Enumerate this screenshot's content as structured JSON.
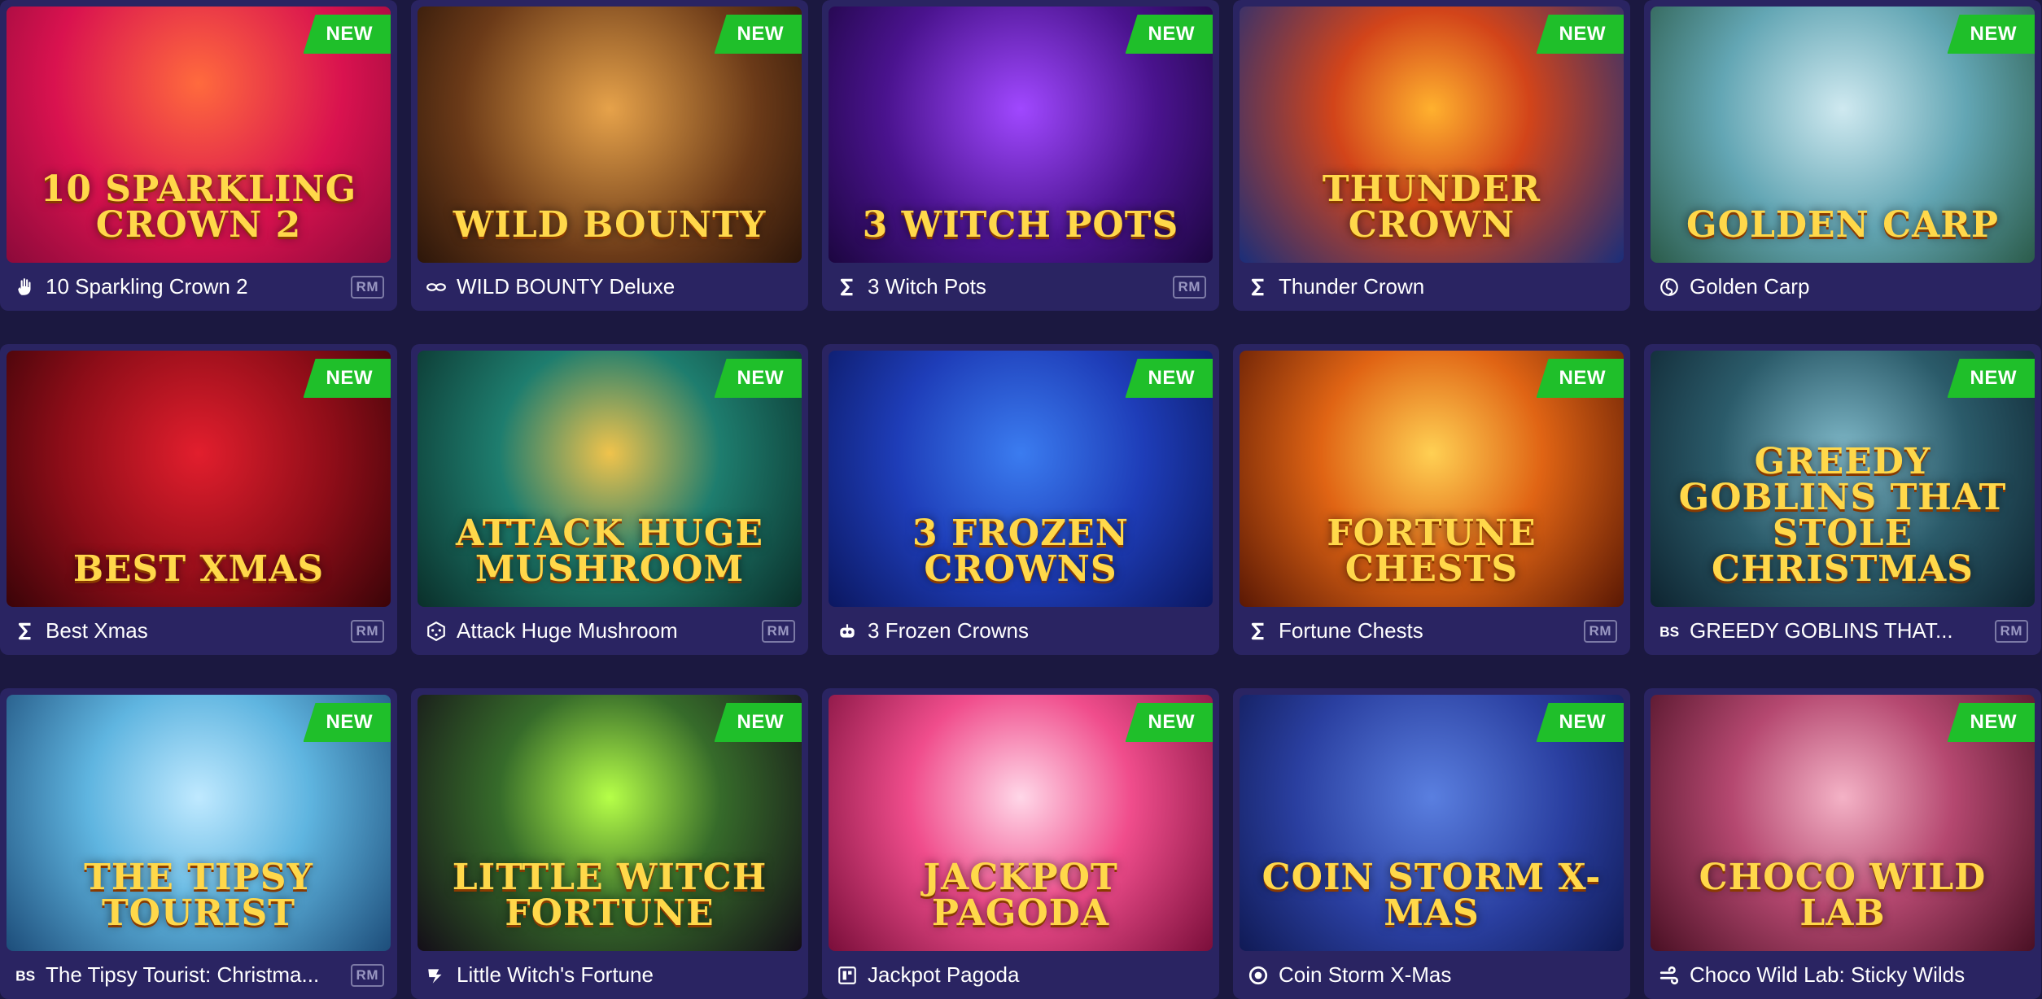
{
  "badge_label": "NEW",
  "rm_label": "RM",
  "colors": {
    "page_bg": "#1b1840",
    "card_bg": "#2a2462",
    "badge_green": "#1fbf2a",
    "rm_border": "#7c7aa6"
  },
  "games": [
    {
      "art": "10 SPARKLING CROWN 2",
      "name": "10 Sparkling Crown 2",
      "provider_icon": "hand-icon",
      "rm": true
    },
    {
      "art": "WILD BOUNTY",
      "name": "WILD BOUNTY Deluxe",
      "provider_icon": "chain-icon",
      "rm": false
    },
    {
      "art": "3 WITCH POTS",
      "name": "3 Witch Pots",
      "provider_icon": "sigma-icon",
      "rm": true
    },
    {
      "art": "THUNDER CROWN",
      "name": "Thunder Crown",
      "provider_icon": "sigma-icon",
      "rm": false
    },
    {
      "art": "Golden Carp",
      "name": "Golden Carp",
      "provider_icon": "swirl-icon",
      "rm": false
    },
    {
      "art": "Best Xmas",
      "name": "Best Xmas",
      "provider_icon": "sigma-icon",
      "rm": true
    },
    {
      "art": "ATTACK HUGE MUSHROOM",
      "name": "Attack Huge Mushroom",
      "provider_icon": "dice-icon",
      "rm": true
    },
    {
      "art": "3 FROZEN CROWNS",
      "name": "3 Frozen Crowns",
      "provider_icon": "robot-icon",
      "rm": false
    },
    {
      "art": "FORTUNE CHESTS",
      "name": "Fortune Chests",
      "provider_icon": "sigma-icon",
      "rm": true
    },
    {
      "art": "Greedy Goblins That Stole Christmas",
      "name": "GREEDY GOBLINS THAT...",
      "provider_icon": "bs-icon",
      "rm": true
    },
    {
      "art": "The Tipsy Tourist",
      "name": "The Tipsy Tourist: Christma...",
      "provider_icon": "bs-icon",
      "rm": true
    },
    {
      "art": "Little Witch Fortune",
      "name": "Little Witch's Fortune",
      "provider_icon": "bolt-icon",
      "rm": false
    },
    {
      "art": "JACKPOT PAGODA",
      "name": "Jackpot Pagoda",
      "provider_icon": "tile-icon",
      "rm": false
    },
    {
      "art": "COIN STORM X-MAS",
      "name": "Coin Storm X-Mas",
      "provider_icon": "target-icon",
      "rm": false
    },
    {
      "art": "CHOCO WILD LAB",
      "name": "Choco Wild Lab: Sticky Wilds",
      "provider_icon": "wind-icon",
      "rm": false
    }
  ]
}
